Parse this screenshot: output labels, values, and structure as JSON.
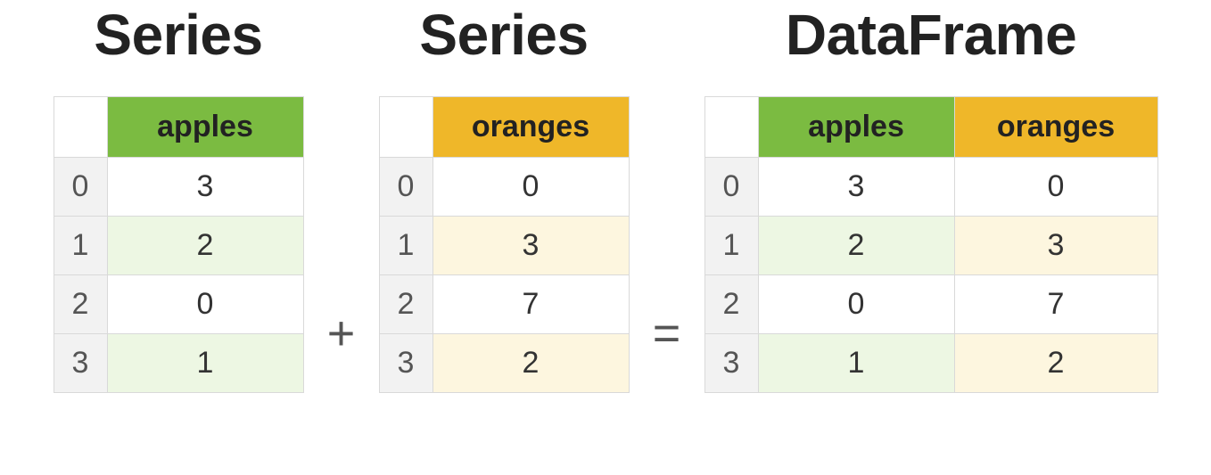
{
  "headings": {
    "series_a": "Series",
    "series_b": "Series",
    "dataframe": "DataFrame"
  },
  "operators": {
    "plus": "+",
    "equals": "="
  },
  "columns": {
    "apples": "apples",
    "oranges": "oranges"
  },
  "index": [
    "0",
    "1",
    "2",
    "3"
  ],
  "series_a": {
    "column": "apples",
    "values": [
      "3",
      "2",
      "0",
      "1"
    ]
  },
  "series_b": {
    "column": "oranges",
    "values": [
      "0",
      "3",
      "7",
      "2"
    ]
  },
  "dataframe": {
    "columns": [
      "apples",
      "oranges"
    ],
    "rows": [
      {
        "apples": "3",
        "oranges": "0"
      },
      {
        "apples": "2",
        "oranges": "3"
      },
      {
        "apples": "0",
        "oranges": "7"
      },
      {
        "apples": "1",
        "oranges": "2"
      }
    ]
  },
  "colors": {
    "green_header": "#7bbb41",
    "orange_header": "#efb729",
    "green_alt_row": "#edf7e3",
    "orange_alt_row": "#fdf6df",
    "index_bg": "#f2f2f2",
    "border": "#d9d9d9"
  }
}
